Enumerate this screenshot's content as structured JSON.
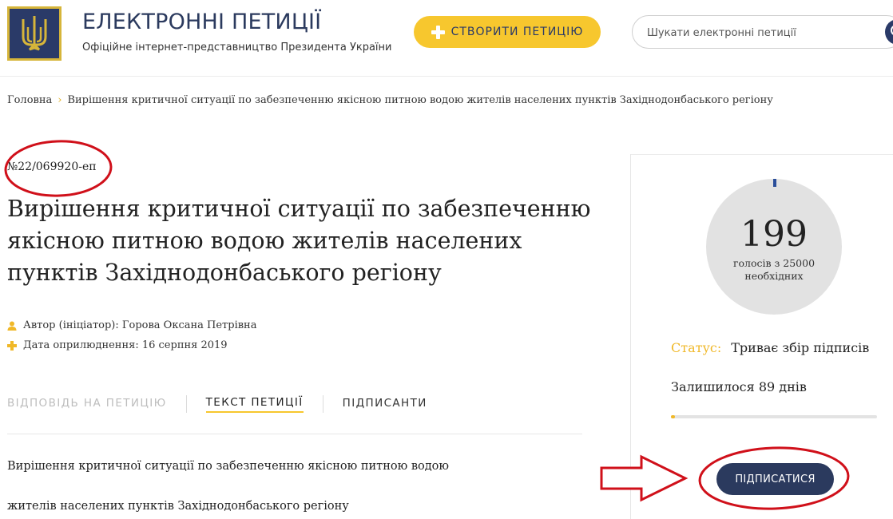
{
  "header": {
    "site_title": "ЕЛЕКТРОННІ ПЕТИЦІЇ",
    "site_subtitle": "Офіційне інтернет-представництво Президента України",
    "create_button": "СТВОРИТИ ПЕТИЦІЮ",
    "search_placeholder": "Шукати електронні петиції"
  },
  "breadcrumb": {
    "home": "Головна",
    "current": "Вирішення критичної ситуації по забезпеченню якісною питною водою жителів населених пунктів Західнодонбаського регіону"
  },
  "petition": {
    "number": "№22/069920-еп",
    "title": "Вирішення критичної ситуації по забезпеченню якісною питною водою жителів населених пунктів Західнодонбаського регіону",
    "author": "Автор (ініціатор): Горова Оксана Петрівна",
    "date": "Дата оприлюднення: 16 серпня 2019",
    "tabs": [
      "ВІДПОВІДЬ НА ПЕТИЦІЮ",
      "ТЕКСТ ПЕТИЦІЇ",
      "ПІДПИСАНТИ"
    ],
    "body_lines": [
      "Вирішення критичної ситуації по забезпеченню якісною питною водою",
      "жителів населених пунктів Західнодонбаського регіону"
    ]
  },
  "sidebar": {
    "votes": "199",
    "votes_caption_1": "голосів з 25000",
    "votes_caption_2": "необхідних",
    "status_label": "Статус:",
    "status_value": "Триває збір підписів",
    "days_left": "Залишилося 89 днів",
    "progress_fraction": 0.008,
    "sign_button": "ПІДПИСАТИСЯ"
  },
  "colors": {
    "brand_navy": "#2b3a5e",
    "accent_yellow": "#f7c72e",
    "annotation_red": "#d0101a"
  },
  "icons": [
    "trident-logo-icon",
    "plus-icon",
    "search-icon",
    "person-icon",
    "plus-small-icon",
    "arrow-right-annotation-icon"
  ]
}
